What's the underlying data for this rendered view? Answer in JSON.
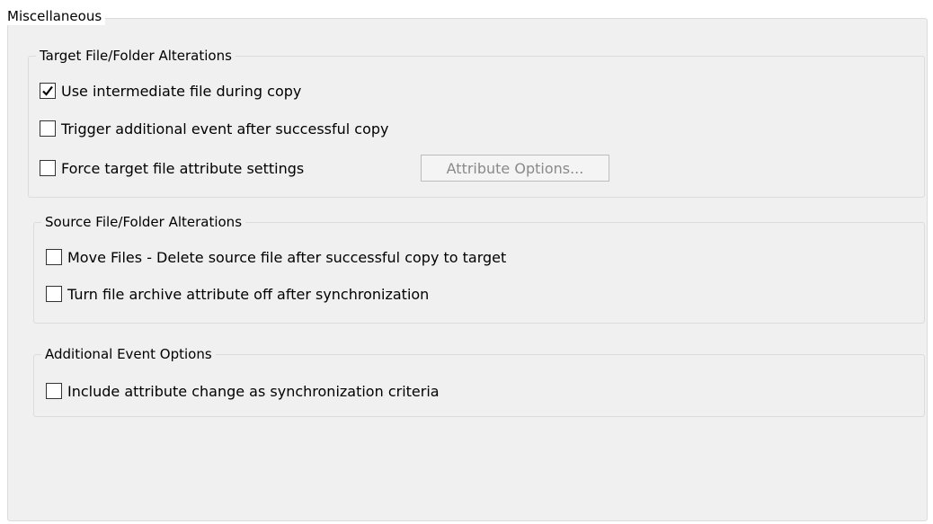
{
  "panel": {
    "title": "Miscellaneous"
  },
  "target_group": {
    "title": "Target File/Folder Alterations",
    "options": [
      {
        "label": "Use intermediate file during copy",
        "checked": true
      },
      {
        "label": "Trigger additional event after successful copy",
        "checked": false
      },
      {
        "label": "Force target file attribute settings",
        "checked": false
      }
    ],
    "attribute_button": {
      "label": "Attribute Options...",
      "enabled": false
    }
  },
  "source_group": {
    "title": "Source File/Folder Alterations",
    "options": [
      {
        "label": "Move Files - Delete source file after successful copy to target",
        "checked": false
      },
      {
        "label": "Turn file archive attribute off after synchronization",
        "checked": false
      }
    ]
  },
  "events_group": {
    "title": "Additional Event Options",
    "options": [
      {
        "label": "Include attribute change as synchronization criteria",
        "checked": false
      }
    ]
  }
}
